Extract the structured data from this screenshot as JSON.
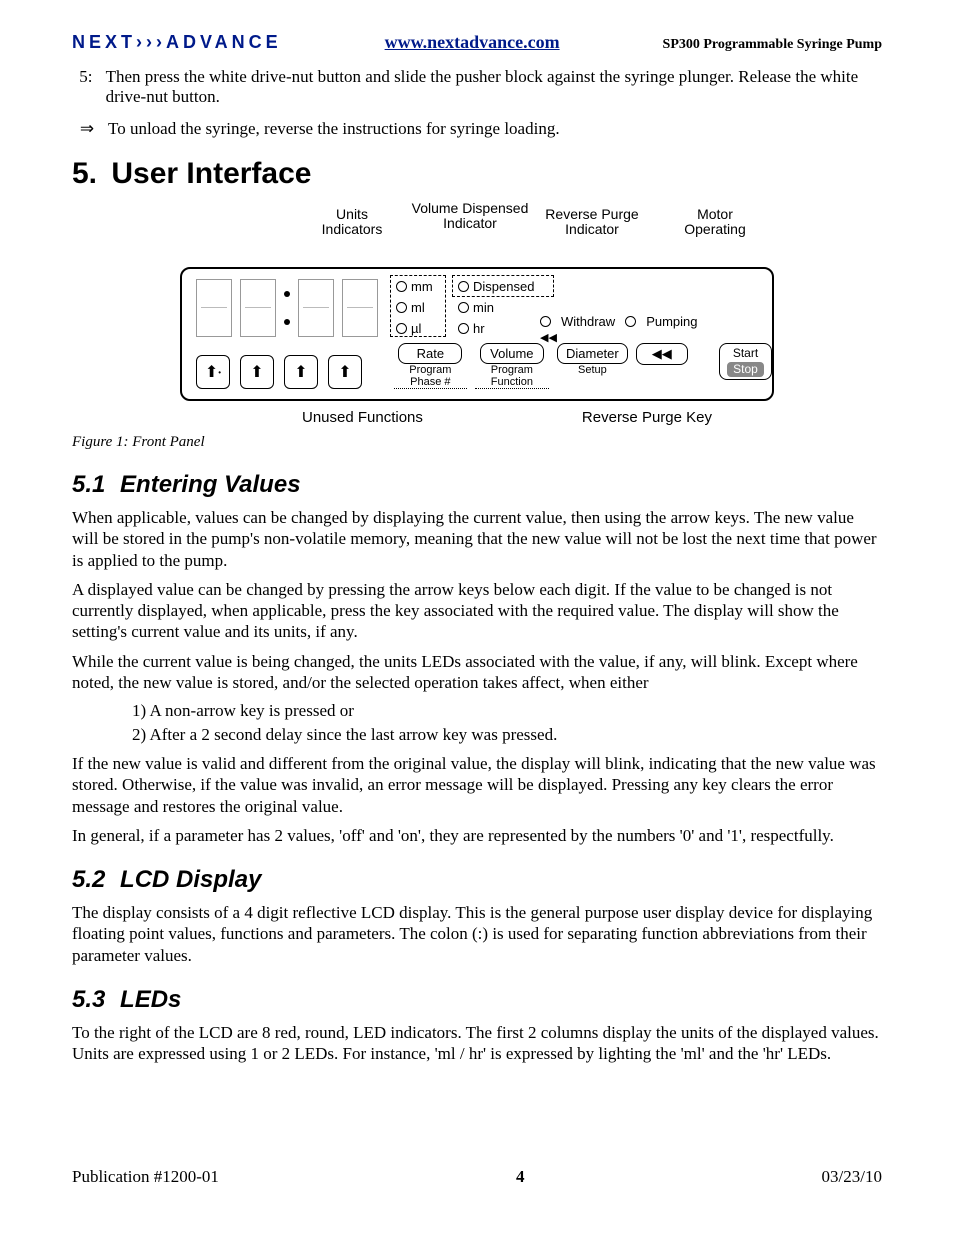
{
  "header": {
    "brand": "NEXT›››ADVANCE",
    "site": "www.nextadvance.com",
    "docTitle": "SP300 Programmable Syringe Pump"
  },
  "topList": {
    "item5_num": "5:",
    "item5": "Then press the white drive-nut button and slide the pusher block against the syringe plunger.  Release the white drive-nut button.",
    "arrowSym": "⇒",
    "arrowText": "To unload the syringe, reverse the instructions for syringe loading."
  },
  "s5": {
    "num": "5.",
    "title": "User Interface"
  },
  "figure": {
    "annot": {
      "units": "Units Indicators",
      "volDisp": "Volume Dispensed Indicator",
      "revPurge": "Reverse Purge Indicator",
      "motor": "Motor Operating"
    },
    "leds": {
      "mm": "mm",
      "ml": "ml",
      "ul": "µl",
      "dispensed": "Dispensed",
      "min": "min",
      "hr": "hr",
      "withdraw": "Withdraw",
      "pumping": "Pumping"
    },
    "revArrowSmall": "◀◀",
    "buttons": {
      "rate": "Rate",
      "volume": "Volume",
      "diameter": "Diameter",
      "start": "Start",
      "stop": "Stop",
      "revKey": "◀◀"
    },
    "sublabels": {
      "progPhase": "Program Phase #",
      "progFunc": "Program Function",
      "setup": "Setup"
    },
    "below": {
      "unused": "Unused Functions",
      "revKey": "Reverse Purge Key"
    },
    "caption": "Figure 1: Front Panel"
  },
  "s51": {
    "num": "5.1",
    "title": "Entering Values",
    "p1": "When applicable, values can be changed by displaying the current value, then using the arrow keys.  The new value will be stored in the pump's non-volatile memory, meaning that the new value will not be lost the next time that power is applied to the pump.",
    "p2": "A displayed value can be changed by pressing the arrow keys below each digit.  If the value to be changed is not currently displayed, when applicable, press the key associated with the required value.  The display will show the setting's current value and its units, if any.",
    "p3": "While the current value is being changed, the units LEDs associated with the value, if any, will blink. Except where noted, the new value is stored, and/or the selected operation takes affect, when either",
    "li1": "1) A non-arrow key is pressed or",
    "li2": "2) After a 2 second delay since the last arrow key was pressed.",
    "p4": "If the new value is valid and different from the original value, the display will blink, indicating that the new value was stored.  Otherwise, if the value was invalid, an error message will be displayed.  Pressing any key clears the error message and restores the original value.",
    "p5": "In general, if a parameter has 2 values, 'off' and 'on', they are represented by the numbers '0' and '1', respectfully."
  },
  "s52": {
    "num": "5.2",
    "title": "LCD Display",
    "p1": "The display consists of a 4 digit reflective LCD display.  This is the general purpose user display device for displaying floating point values, functions and parameters.  The colon (:) is used for separating function abbreviations from their parameter values."
  },
  "s53": {
    "num": "5.3",
    "title": "LEDs",
    "p1": "To the right of the LCD are 8 red, round, LED indicators.  The first 2 columns display the units of the displayed values.  Units are expressed using 1 or 2 LEDs.  For instance, 'ml / hr' is expressed by lighting the 'ml' and the 'hr' LEDs."
  },
  "footer": {
    "pub": "Publication  #1200-01",
    "page": "4",
    "date": "03/23/10"
  }
}
